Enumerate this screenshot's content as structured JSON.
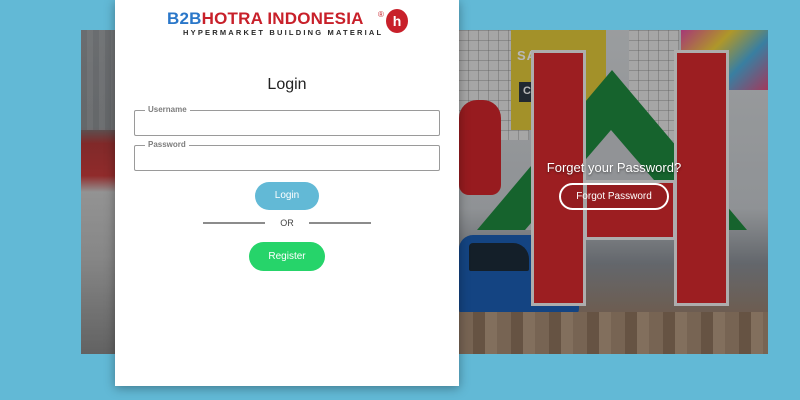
{
  "logo": {
    "b2b": "B2B",
    "brand": "HOTRA INDONESIA",
    "registered": "®",
    "tagline": "HYPERMARKET BUILDING MATERIAL",
    "badge": "h"
  },
  "login": {
    "title": "Login",
    "username_label": "Username",
    "username_value": "",
    "password_label": "Password",
    "password_value": "",
    "login_button": "Login",
    "or_text": "OR",
    "register_button": "Register"
  },
  "forgot": {
    "text": "Forget your Password?",
    "button": "Forgot Password"
  },
  "background": {
    "sign_text": "SA  AS",
    "sign_sub": "Co  a"
  },
  "colors": {
    "page_bg": "#62b9d6",
    "login_button": "#62b9d6",
    "register_button": "#26d46a",
    "brand_blue": "#2a77c9",
    "brand_red": "#c8202a"
  }
}
